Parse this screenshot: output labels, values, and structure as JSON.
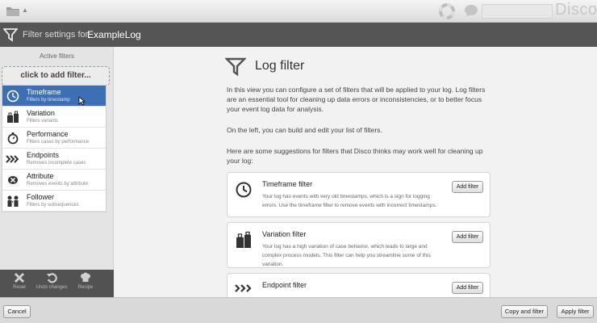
{
  "app": {
    "brand": "Disco"
  },
  "header": {
    "caption": "Filter settings for:",
    "log_name": "ExampleLog"
  },
  "sidebar": {
    "title": "Active filters",
    "add_label": "click to add filter...",
    "filters": [
      {
        "name": "Timeframe",
        "desc": "Filters by timestamp",
        "icon": "clock-icon"
      },
      {
        "name": "Variation",
        "desc": "Filters variants",
        "icon": "luggage-icon"
      },
      {
        "name": "Performance",
        "desc": "Filters cases by performance",
        "icon": "stopwatch-icon"
      },
      {
        "name": "Endpoints",
        "desc": "Removes incomplete cases",
        "icon": "chevrons-icon"
      },
      {
        "name": "Attribute",
        "desc": "Removes events by attribute",
        "icon": "eraser-icon"
      },
      {
        "name": "Follower",
        "desc": "Filters by subsequences",
        "icon": "people-icon"
      }
    ],
    "footer": {
      "reset": "Reset",
      "undo": "Undo changes",
      "recipe": "Recipe"
    }
  },
  "main": {
    "title": "Log filter",
    "paragraphs": [
      "In this view you can configure a set of filters that will be applied to your log. Log filters are an essential tool for cleaning up data errors or inconsistencies, or to better focus your event log data for analysis.",
      "On the left, you can build and edit your list of filters.",
      "Here are some suggestions for filters that Disco thinks may work well for cleaning up your log:"
    ],
    "suggestions": [
      {
        "title": "Timeframe filter",
        "desc": "Your log has events with very old timestamps, which is a sign for logging errors. Use the timeframe filter to remove events with incorrect timestamps.",
        "button": "Add filter"
      },
      {
        "title": "Variation filter",
        "desc": "Your log has a high variation of case behavior, which leads to large and complex process models. This filter can help you streamline some of this variation.",
        "button": "Add filter"
      },
      {
        "title": "Endpoint filter",
        "desc": "",
        "button": "Add filter"
      }
    ]
  },
  "footer": {
    "cancel": "Cancel",
    "copy_and_filter": "Copy and filter",
    "apply_filter": "Apply filter"
  },
  "colors": {
    "selected": "#3d6fb6",
    "header_bg": "#555555"
  }
}
